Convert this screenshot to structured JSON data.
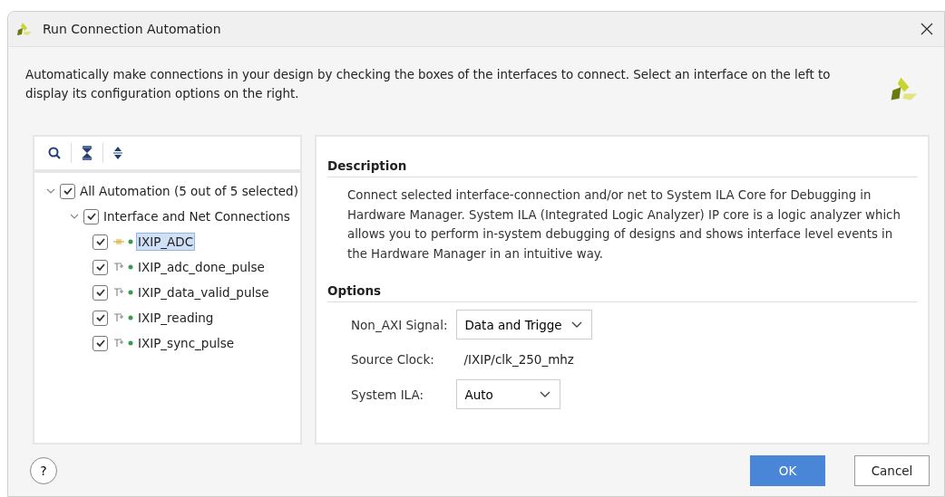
{
  "window": {
    "title": "Run Connection Automation"
  },
  "intro": "Automatically make connections in your design by checking the boxes of the interfaces to connect. Select an interface on the left to display its configuration options on the right.",
  "tree": [
    {
      "label": "All Automation (5 out of 5 selected)",
      "checked": true,
      "expanded": true,
      "children": [
        {
          "label": "Interface and Net Connections",
          "checked": true,
          "expanded": true,
          "children": [
            {
              "label": "IXIP_ADC",
              "kind": "interface",
              "checked": true,
              "selected": true
            },
            {
              "label": "IXIP_adc_done_pulse",
              "kind": "net",
              "checked": true,
              "selected": false
            },
            {
              "label": "IXIP_data_valid_pulse",
              "kind": "net",
              "checked": true,
              "selected": false
            },
            {
              "label": "IXIP_reading",
              "kind": "net",
              "checked": true,
              "selected": false
            },
            {
              "label": "IXIP_sync_pulse",
              "kind": "net",
              "checked": true,
              "selected": false
            }
          ]
        }
      ]
    }
  ],
  "description": {
    "heading": "Description",
    "text": "Connect selected interface-connection and/or net to System ILA Core for Debugging in Hardware Manager. System ILA (Integrated Logic Analyzer) IP core is a logic analyzer which allows you to perform in-system debugging of designs and shows interface level events in the Hardware Manager in an intuitive way."
  },
  "options": {
    "heading": "Options",
    "fields": [
      {
        "label": "Non_AXI Signal:",
        "kind": "dropdown",
        "value": "Data and Trigge"
      },
      {
        "label": "Source Clock:",
        "kind": "text",
        "value": "/IXIP/clk_250_mhz"
      },
      {
        "label": "System ILA:",
        "kind": "dropdown",
        "value": "Auto"
      }
    ]
  },
  "help_button": "?",
  "buttons": [
    {
      "label": "OK",
      "kind": "primary"
    },
    {
      "label": "Cancel",
      "kind": "secondary"
    }
  ]
}
